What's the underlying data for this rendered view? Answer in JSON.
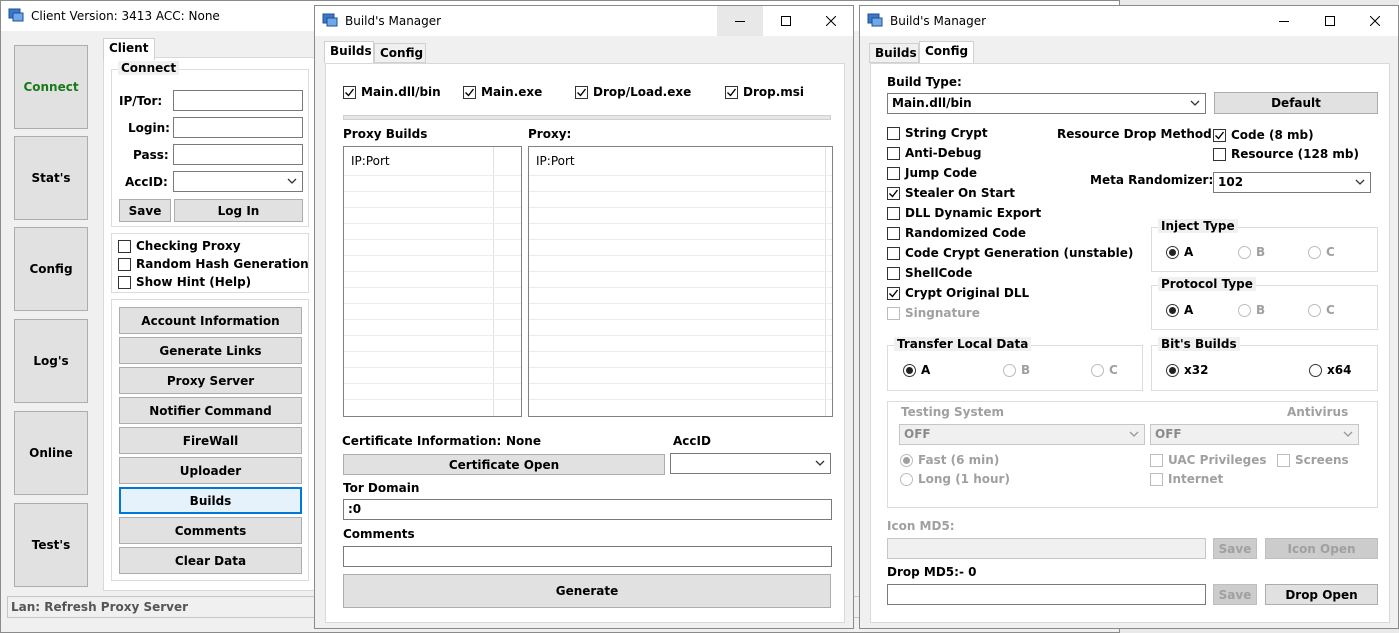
{
  "client": {
    "title": "Client Version: 3413 ACC: None",
    "side_buttons": [
      "Connect",
      "Stat's",
      "Config",
      "Log's",
      "Online",
      "Test's"
    ],
    "tab": "Client",
    "connect_group": "Connect",
    "ip_label": "IP/Tor:",
    "login_label": "Login:",
    "pass_label": "Pass:",
    "accid_label": "AccID:",
    "save_label": "Save",
    "login_button": "Log In",
    "options": [
      "Checking Proxy",
      "Random Hash Generation",
      "Show Hint (Help)"
    ],
    "actions": [
      "Account Information",
      "Generate Links",
      "Proxy Server",
      "Notifier Command",
      "FireWall",
      "Uploader",
      "Builds",
      "Comments",
      "Clear Data"
    ],
    "status": "Lan: Refresh Proxy Server",
    "connect_color": "#1a7a1a"
  },
  "bm1": {
    "title": "Build's Manager",
    "tabs": [
      "Builds",
      "Config"
    ],
    "checks": [
      "Main.dll/bin",
      "Main.exe",
      "Drop/Load.exe",
      "Drop.msi"
    ],
    "proxy_builds_label": "Proxy Builds",
    "proxy_label": "Proxy:",
    "proxy_builds_header": "IP:Port",
    "proxy_header": "IP:Port",
    "cert_label": "Certificate Information:",
    "cert_value": "None",
    "accid_label": "AccID",
    "cert_open": "Certificate Open",
    "tor_label": "Tor Domain",
    "tor_value": ":0",
    "comments_label": "Comments",
    "generate": "Generate"
  },
  "bm2": {
    "title": "Build's Manager",
    "tabs": [
      "Builds",
      "Config"
    ],
    "build_type_label": "Build Type:",
    "build_type_value": "Main.dll/bin",
    "default_button": "Default",
    "options": [
      "String Crypt",
      "Anti-Debug",
      "Jump Code",
      "Stealer On Start",
      "DLL Dynamic Export",
      "Randomized Code",
      "Code Crypt Generation (unstable)",
      "ShellCode",
      "Crypt Original DLL",
      "Singnature"
    ],
    "resource_drop_label": "Resource Drop Method:",
    "code_option": "Code (8 mb)",
    "resource_option": "Resource (128 mb)",
    "meta_label": "Meta Randomizer:",
    "meta_value": "102",
    "inject_type": "Inject Type",
    "protocol_type": "Protocol Type",
    "transfer_label": "Transfer Local Data",
    "bits_label": "Bit's Builds",
    "abc": [
      "A",
      "B",
      "C"
    ],
    "x32": "x32",
    "x64": "x64",
    "testing_label": "Testing System",
    "antivirus_label": "Antivirus",
    "testing_value": "OFF",
    "antivirus_value": "OFF",
    "fast": "Fast (6 min)",
    "long": "Long (1 hour)",
    "uac": "UAC Privileges",
    "screens": "Screens",
    "internet": "Internet",
    "icon_md5_label": "Icon MD5:",
    "save_label": "Save",
    "icon_open": "Icon Open",
    "drop_md5_label": "Drop MD5:",
    "drop_md5_value": "- 0",
    "drop_open": "Drop Open"
  }
}
